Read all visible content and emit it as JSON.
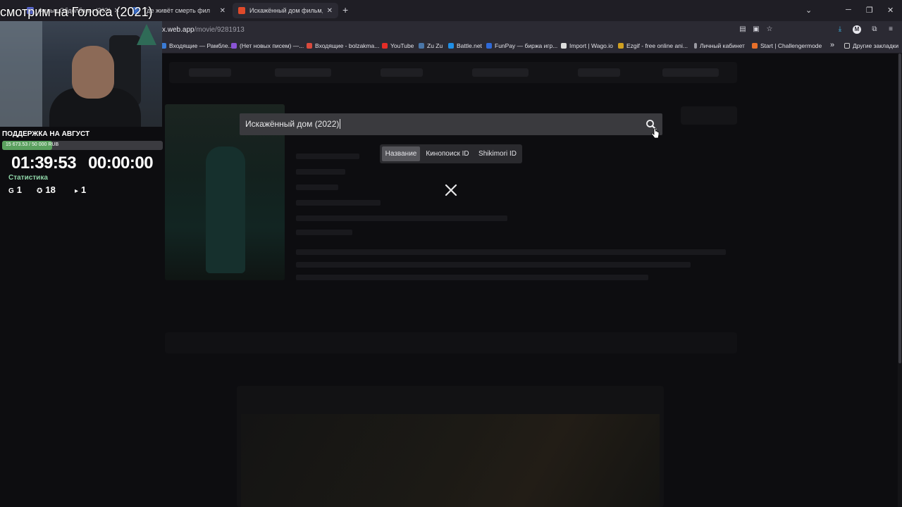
{
  "browser": {
    "tabs": [
      {
        "label": "Фильм Обдолбаны (2020)",
        "favicon_color": "#5b6bd8"
      },
      {
        "label": "Где живёт смерть фил",
        "favicon_color": "#3a6fd0"
      },
      {
        "label": "Искажённый дом фильм, 2022",
        "favicon_color": "#e04a2a"
      }
    ],
    "tab_close_glyph": "✕",
    "new_tab_glyph": "+",
    "url_host": "x.web.app",
    "url_path": "/movie/9281913",
    "bookmarks": [
      {
        "label": "Входящие — Рамбле...",
        "color": "#3a7bd5"
      },
      {
        "label": "(Нет новых писем) —...",
        "color": "#8a54d6"
      },
      {
        "label": "Входящие - bolzakma...",
        "color": "#d94a3d"
      },
      {
        "label": "YouTube",
        "color": "#e52d27"
      },
      {
        "label": "Zu Zu",
        "color": "#4a76a8"
      },
      {
        "label": "Battle.net",
        "color": "#1f8fe6"
      },
      {
        "label": "FunPay — биржа игр...",
        "color": "#2f6ad9"
      },
      {
        "label": "Import | Wago.io",
        "color": "#dddddd"
      },
      {
        "label": "Ezgif - free online ani...",
        "color": "#d0a020"
      },
      {
        "label": "Личный кабинет",
        "color": "#9a9aa2"
      },
      {
        "label": "Start | Challengermode",
        "color": "#e8702a"
      }
    ],
    "other_bookmarks": "Другие закладки",
    "more_bookmarks_glyph": "»"
  },
  "search": {
    "query": "Искажённый дом (2022)",
    "icon": "search-icon",
    "modes": [
      "Название",
      "Кинопоиск ID",
      "Shikimori ID"
    ],
    "active_mode": "Название",
    "close_glyph": "✕"
  },
  "stream": {
    "title": "смотрим на Голоса (2021)",
    "donation_label": "ПОДДЕРЖКА НА АВГУСТ",
    "donation_text": "15 673.53 / 50 000 RUB",
    "donation_progress": 0.3135,
    "timer_elapsed": "01:39:53",
    "timer_countdown": "00:00:00",
    "stats_label": "Статистика",
    "stats": [
      {
        "icon": "G",
        "value": "1"
      },
      {
        "icon": "✪",
        "value": "18"
      },
      {
        "icon": "▸",
        "value": "1"
      }
    ]
  },
  "colors": {
    "accent_green": "#5aa05e",
    "stats_green": "#8fd6a8",
    "search_bg": "#3a3a3e"
  }
}
